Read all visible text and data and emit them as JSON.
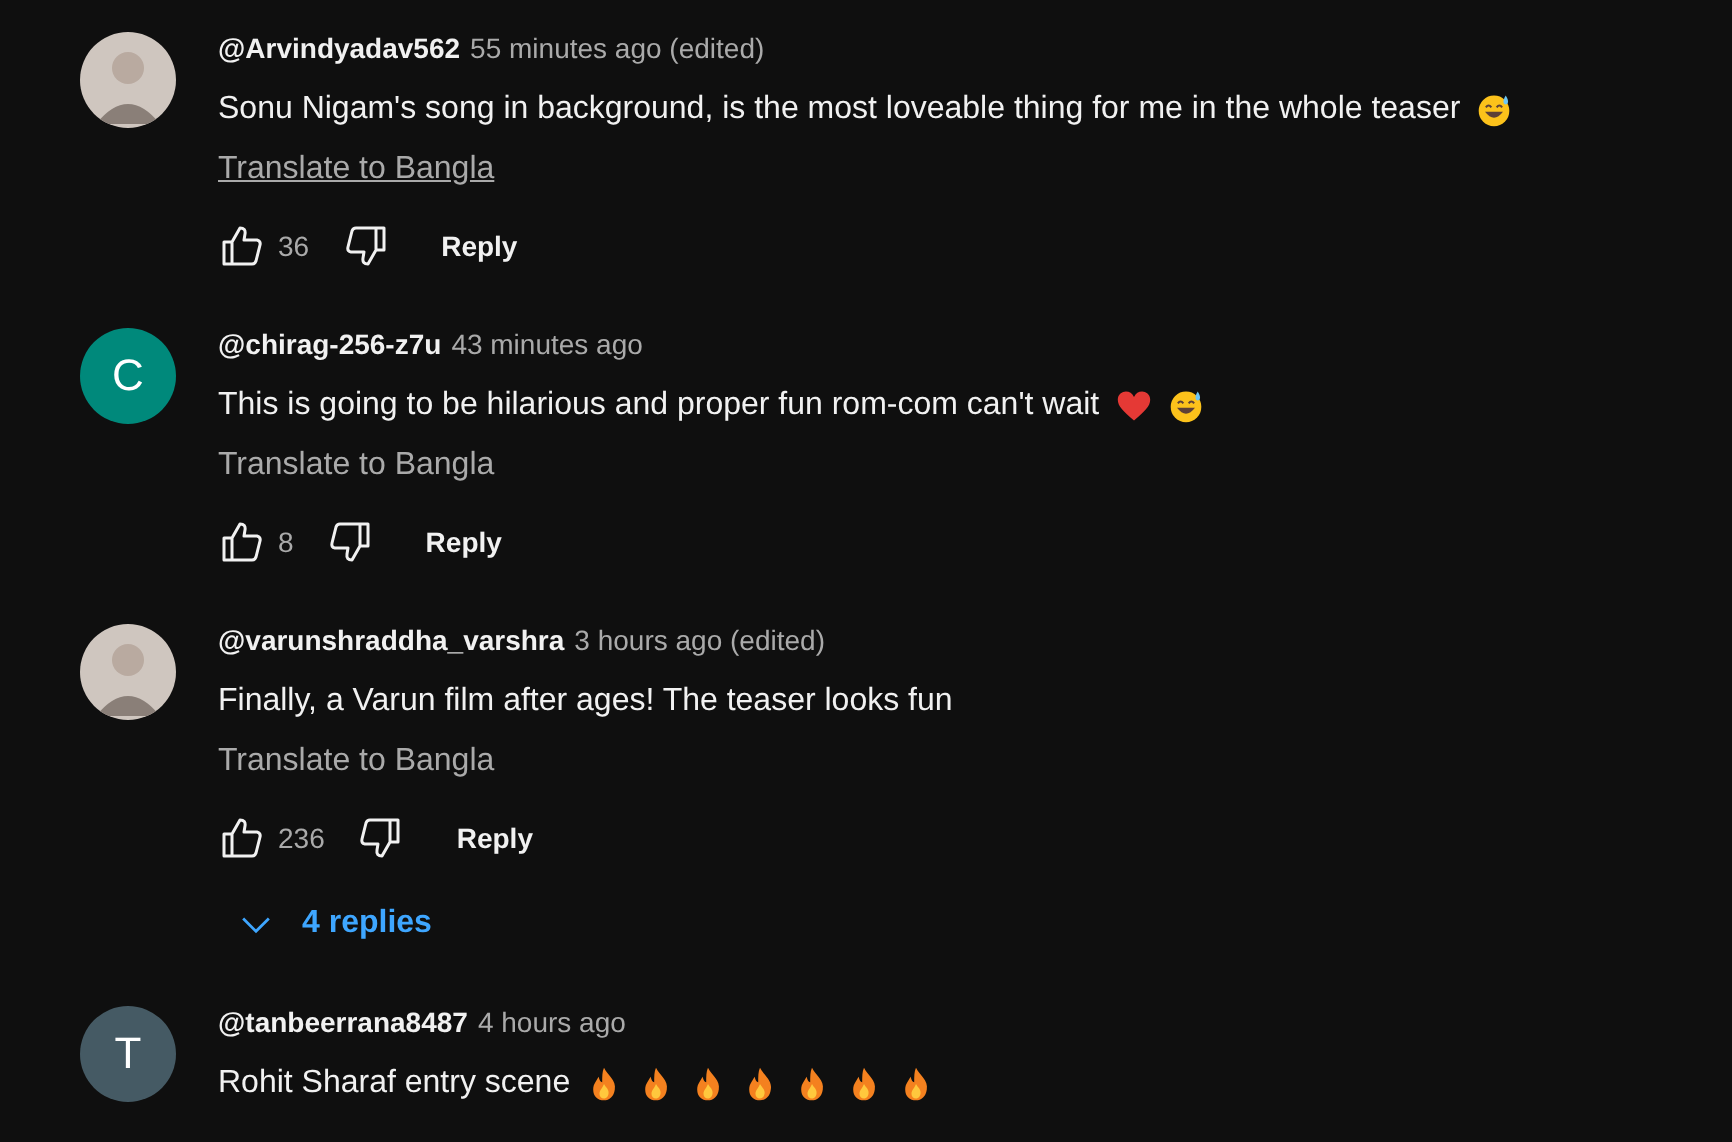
{
  "comments": [
    {
      "avatar": {
        "kind": "photo"
      },
      "author": "@Arvindyadav562",
      "time": "55 minutes ago (edited)",
      "text": "Sonu Nigam's song in background, is the most loveable thing for me in the whole teaser",
      "emojis": [
        {
          "kind": "sweat-smile"
        }
      ],
      "translate": {
        "label": "Translate to Bangla",
        "hovered": true
      },
      "likes": "36",
      "reply": "Reply"
    },
    {
      "avatar": {
        "kind": "letter",
        "letter": "C",
        "color": "#00897b"
      },
      "author": "@chirag-256-z7u",
      "time": "43 minutes ago",
      "text": "This is going to be hilarious and proper fun rom-com can't wait",
      "emojis": [
        {
          "kind": "heart"
        },
        {
          "kind": "sweat-smile"
        }
      ],
      "translate": {
        "label": "Translate to Bangla",
        "hovered": false
      },
      "likes": "8",
      "reply": "Reply"
    },
    {
      "avatar": {
        "kind": "photo"
      },
      "author": "@varunshraddha_varshra",
      "time": "3 hours ago (edited)",
      "text": "Finally, a Varun film after ages! The teaser looks fun",
      "translate": {
        "label": "Translate to Bangla",
        "hovered": false
      },
      "likes": "236",
      "reply": "Reply",
      "replies": "4 replies"
    },
    {
      "avatar": {
        "kind": "letter",
        "letter": "T",
        "color": "#455a64"
      },
      "author": "@tanbeerrana8487",
      "time": "4 hours ago",
      "text": "Rohit Sharaf entry scene",
      "emojis": [
        {
          "kind": "fire"
        },
        {
          "kind": "fire"
        },
        {
          "kind": "fire"
        },
        {
          "kind": "fire"
        },
        {
          "kind": "fire"
        },
        {
          "kind": "fire"
        },
        {
          "kind": "fire"
        }
      ]
    }
  ]
}
